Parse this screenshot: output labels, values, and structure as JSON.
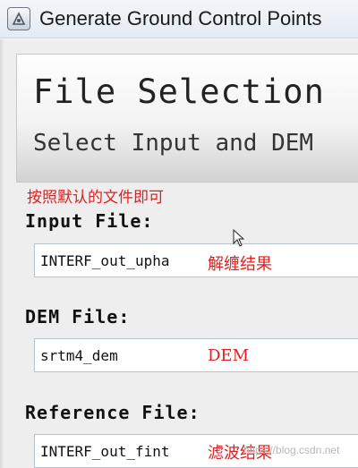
{
  "window": {
    "title": "Generate Ground Control Points",
    "icon": "app-window-icon"
  },
  "header": {
    "title": "File Selection",
    "subtitle": "Select Input and DEM"
  },
  "annotations": {
    "note_top": "按照默认的文件即可",
    "input_note": "解缠结果",
    "dem_note": "DEM",
    "reference_note": "滤波结果"
  },
  "fields": {
    "input": {
      "label": "Input File:",
      "value": "INTERF_out_upha"
    },
    "dem": {
      "label": "DEM File:",
      "value": "srtm4_dem"
    },
    "reference": {
      "label": "Reference File:",
      "value": "INTERF_out_fint"
    }
  },
  "watermark": "https://blog.csdn.net",
  "colors": {
    "annotation": "#e02020",
    "title_bar": "#e9eef4",
    "field_border": "#b9c3cd"
  }
}
